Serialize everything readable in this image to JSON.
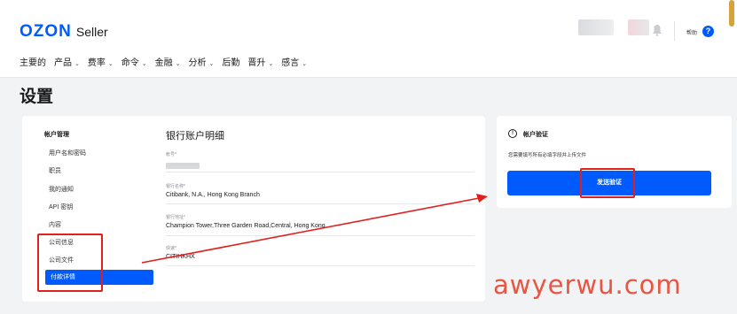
{
  "header": {
    "logo_brand": "OZON",
    "logo_product": "Seller",
    "help_label": "帮助",
    "help_glyph": "?"
  },
  "nav": {
    "items": [
      {
        "label": "主要的",
        "has_dropdown": false
      },
      {
        "label": "产品",
        "has_dropdown": true
      },
      {
        "label": "费率",
        "has_dropdown": true
      },
      {
        "label": "命令",
        "has_dropdown": true
      },
      {
        "label": "金融",
        "has_dropdown": true
      },
      {
        "label": "分析",
        "has_dropdown": true
      },
      {
        "label": "后勤",
        "has_dropdown": false
      },
      {
        "label": "晋升",
        "has_dropdown": true
      },
      {
        "label": "感言",
        "has_dropdown": true
      }
    ],
    "dropdown_glyph": "⌄"
  },
  "page": {
    "title": "设置"
  },
  "sidebar": {
    "heading": "帐户管理",
    "items": [
      {
        "label": "用户名和密码"
      },
      {
        "label": "职员"
      },
      {
        "label": "我的通知"
      },
      {
        "label": "API 密钥"
      },
      {
        "label": "内容"
      },
      {
        "label": "公司信息"
      },
      {
        "label": "公司文件"
      }
    ],
    "active_item": "付款详情"
  },
  "bank": {
    "title": "银行账户明细",
    "fields": [
      {
        "label": "帐号*",
        "value": ""
      },
      {
        "label": "银行名称*",
        "value": "Citibank, N.A., Hong Kong Branch"
      },
      {
        "label": "银行地址*",
        "value": "Champion Tower,Three Garden Road,Central, Hong Kong"
      },
      {
        "label": "快速*",
        "value": "CITIHKHX"
      }
    ]
  },
  "verification": {
    "info_glyph": "!",
    "title": "帐户验证",
    "note": "您需要填写所有必填字段并上传文件",
    "button_label": "发送验证"
  },
  "watermark": "awyerwu.com",
  "colors": {
    "accent": "#005bff",
    "highlight_red": "#e0201c",
    "watermark": "#e8452d"
  }
}
